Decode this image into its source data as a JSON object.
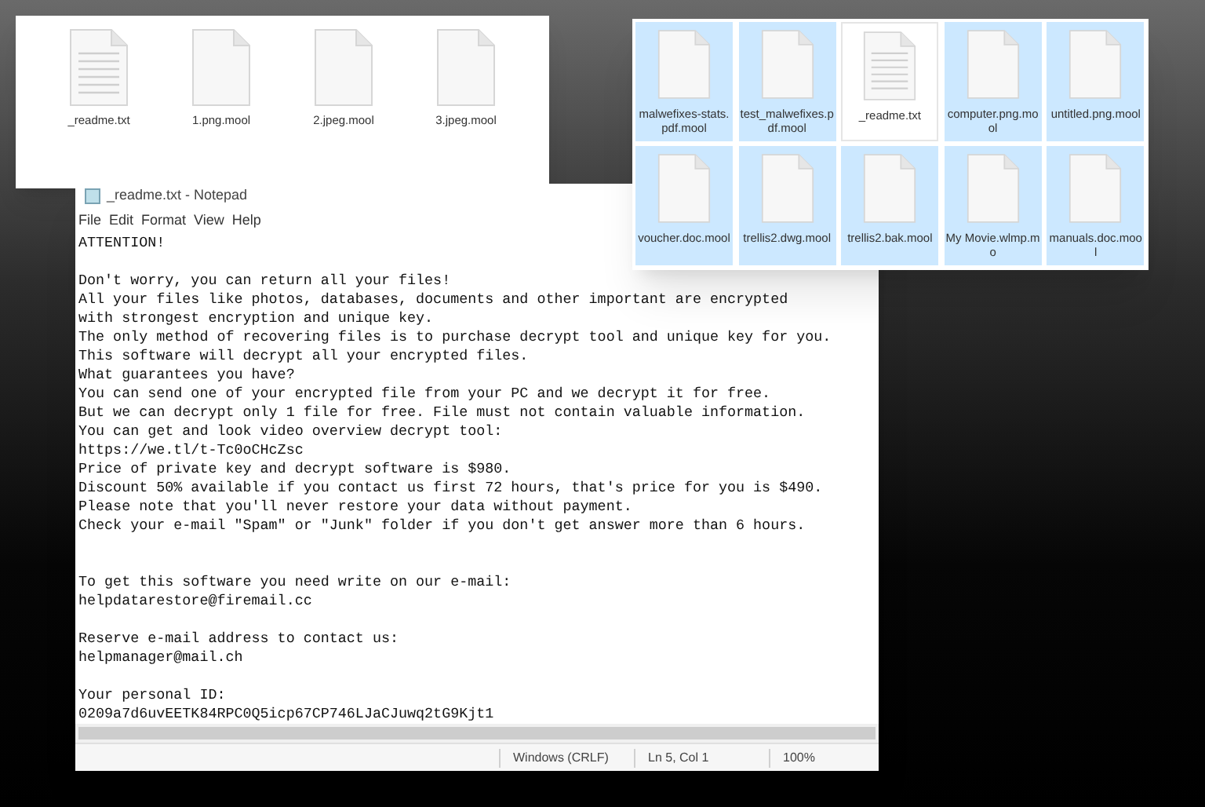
{
  "explorer_windows": [
    {
      "files": [
        {
          "name": "_readme.txt",
          "kind": "text",
          "selected": false
        },
        {
          "name": "1.png.mool",
          "kind": "blank",
          "selected": false
        },
        {
          "name": "2.jpeg.mool",
          "kind": "blank",
          "selected": false
        },
        {
          "name": "3.jpeg.mool",
          "kind": "blank",
          "selected": false
        }
      ]
    },
    {
      "files": [
        {
          "name": "malwefixes-stats.pdf.mool",
          "kind": "blank",
          "selected": true
        },
        {
          "name": "test_malwefixes.pdf.mool",
          "kind": "blank",
          "selected": true
        },
        {
          "name": "_readme.txt",
          "kind": "text",
          "selected": false
        },
        {
          "name": "computer.png.mool",
          "kind": "blank",
          "selected": true
        },
        {
          "name": "untitled.png.mool",
          "kind": "blank",
          "selected": true
        },
        {
          "name": "voucher.doc.mool",
          "kind": "blank",
          "selected": true
        },
        {
          "name": "trellis2.dwg.mool",
          "kind": "blank",
          "selected": true
        },
        {
          "name": "trellis2.bak.mool",
          "kind": "blank",
          "selected": true
        },
        {
          "name": "My Movie.wlmp.mo",
          "kind": "blank",
          "selected": true
        },
        {
          "name": "manuals.doc.mool",
          "kind": "blank",
          "selected": true
        }
      ]
    }
  ],
  "notepad": {
    "title": "_readme.txt - Notepad",
    "menu": [
      "File",
      "Edit",
      "Format",
      "View",
      "Help"
    ],
    "text": "ATTENTION!\n\nDon't worry, you can return all your files!\nAll your files like photos, databases, documents and other important are encrypted\nwith strongest encryption and unique key.\nThe only method of recovering files is to purchase decrypt tool and unique key for you.\nThis software will decrypt all your encrypted files.\nWhat guarantees you have?\nYou can send one of your encrypted file from your PC and we decrypt it for free.\nBut we can decrypt only 1 file for free. File must not contain valuable information.\nYou can get and look video overview decrypt tool:\nhttps://we.tl/t-Tc0oCHcZsc\nPrice of private key and decrypt software is $980.\nDiscount 50% available if you contact us first 72 hours, that's price for you is $490.\nPlease note that you'll never restore your data without payment.\nCheck your e-mail \"Spam\" or \"Junk\" folder if you don't get answer more than 6 hours.\n\n\nTo get this software you need write on our e-mail:\nhelpdatarestore@firemail.cc\n\nReserve e-mail address to contact us:\nhelpmanager@mail.ch\n\nYour personal ID:\n0209a7d6uvEETK84RPC0Q5icp67CP746LJaCJuwq2tG9Kjt1",
    "status_bar": [
      "Windows (CRLF)",
      "Ln 5, Col 1",
      "100%"
    ]
  }
}
